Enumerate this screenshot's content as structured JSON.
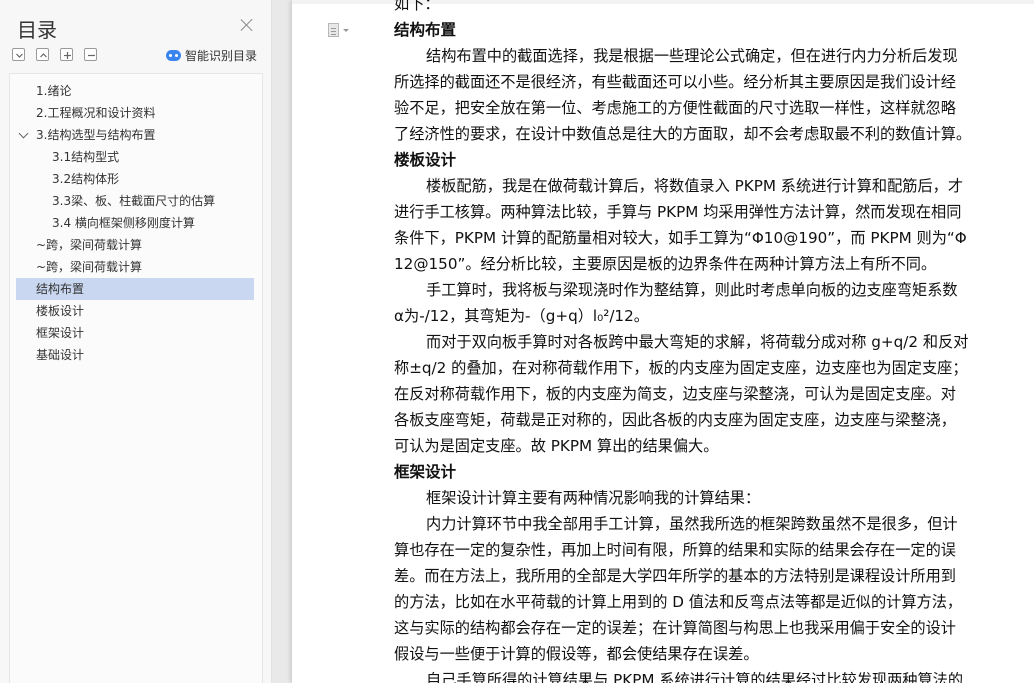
{
  "sidebar": {
    "title": "目录",
    "smart_toc_label": "智能识别目录",
    "items": [
      {
        "label": "1.绪论",
        "level": 1
      },
      {
        "label": "2.工程概况和设计资料",
        "level": 1
      },
      {
        "label": "3.结构选型与结构布置",
        "level": 1,
        "expanded": true
      },
      {
        "label": "3.1结构型式",
        "level": 2
      },
      {
        "label": "3.2结构体形",
        "level": 2
      },
      {
        "label": "3.3梁、板、柱截面尺寸的估算",
        "level": 2
      },
      {
        "label": "3.4  横向框架侧移刚度计算",
        "level": 2
      },
      {
        "label": "~跨，梁间荷载计算",
        "level": 1
      },
      {
        "label": "~跨，梁间荷载计算",
        "level": 1
      },
      {
        "label": "结构布置",
        "level": 1,
        "active": true
      },
      {
        "label": "楼板设计",
        "level": 1
      },
      {
        "label": "框架设计",
        "level": 1
      },
      {
        "label": "基础设计",
        "level": 1
      }
    ]
  },
  "document": {
    "lines": [
      {
        "text": "如下：",
        "style": "normal"
      },
      {
        "text": "结构布置",
        "style": "heading"
      },
      {
        "text": "结构布置中的截面选择，我是根据一些理论公式确定，但在进行内力分析后发现",
        "style": "indent"
      },
      {
        "text": "所选择的截面还不是很经济，有些截面还可以小些。经分析其主要原因是我们设计经",
        "style": "normal"
      },
      {
        "text": "验不足，把安全放在第一位、考虑施工的方便性截面的尺寸选取一样性，这样就忽略",
        "style": "normal"
      },
      {
        "text": "了经济性的要求，在设计中数值总是往大的方面取，却不会考虑取最不利的数值计算。",
        "style": "normal"
      },
      {
        "text": "楼板设计",
        "style": "heading"
      },
      {
        "text": "楼板配筋，我是在做荷载计算后，将数值录入 PKPM 系统进行计算和配筋后，才",
        "style": "indent"
      },
      {
        "text": "进行手工核算。两种算法比较，手算与 PKPM 均采用弹性方法计算，然而发现在相同",
        "style": "normal"
      },
      {
        "text": "条件下，PKPM 计算的配筋量相对较大，如手工算为“Φ10@190”，而 PKPM 则为“Φ",
        "style": "normal"
      },
      {
        "text": "12@150”。经分析比较，主要原因是板的边界条件在两种计算方法上有所不同。",
        "style": "normal"
      },
      {
        "text": "手工算时，我将板与梁现浇时作为整结算，则此时考虑单向板的边支座弯矩系数",
        "style": "indent"
      },
      {
        "text": "α为-/12，其弯矩为-（g+q）l₀²/12。",
        "style": "normal"
      },
      {
        "text": "而对于双向板手算时对各板跨中最大弯矩的求解，将荷载分成对称 g+q/2 和反对",
        "style": "indent"
      },
      {
        "text": "称±q/2 的叠加，在对称荷载作用下，板的内支座为固定支座，边支座也为固定支座；",
        "style": "normal"
      },
      {
        "text": "在反对称荷载作用下，板的内支座为简支，边支座与梁整浇，可认为是固定支座。对",
        "style": "normal"
      },
      {
        "text": "各板支座弯矩，荷载是正对称的，因此各板的内支座为固定支座，边支座与梁整浇，",
        "style": "normal"
      },
      {
        "text": "可认为是固定支座。故 PKPM 算出的结果偏大。",
        "style": "normal"
      },
      {
        "text": "框架设计",
        "style": "heading"
      },
      {
        "text": "框架设计计算主要有两种情况影响我的计算结果：",
        "style": "indent"
      },
      {
        "text": "内力计算环节中我全部用手工计算，虽然我所选的框架跨数虽然不是很多，但计",
        "style": "indent"
      },
      {
        "text": "算也存在一定的复杂性，再加上时间有限，所算的结果和实际的结果会存在一定的误",
        "style": "normal"
      },
      {
        "text": "差。而在方法上，我所用的全部是大学四年所学的基本的方法特别是课程设计所用到",
        "style": "normal"
      },
      {
        "text": "的方法，比如在水平荷载的计算上用到的 D 值法和反弯点法等都是近似的计算方法，",
        "style": "normal"
      },
      {
        "text": "这与实际的结构都会存在一定的误差；在计算简图与构思上也我采用偏于安全的设计",
        "style": "normal"
      },
      {
        "text": "假设与一些便于计算的假设等，都会使结果存在误差。",
        "style": "normal"
      },
      {
        "text": "自己手算所得的计算结果与 PKPM 系统进行计算的结果经过比较发现两种算法的",
        "style": "indent"
      }
    ]
  }
}
